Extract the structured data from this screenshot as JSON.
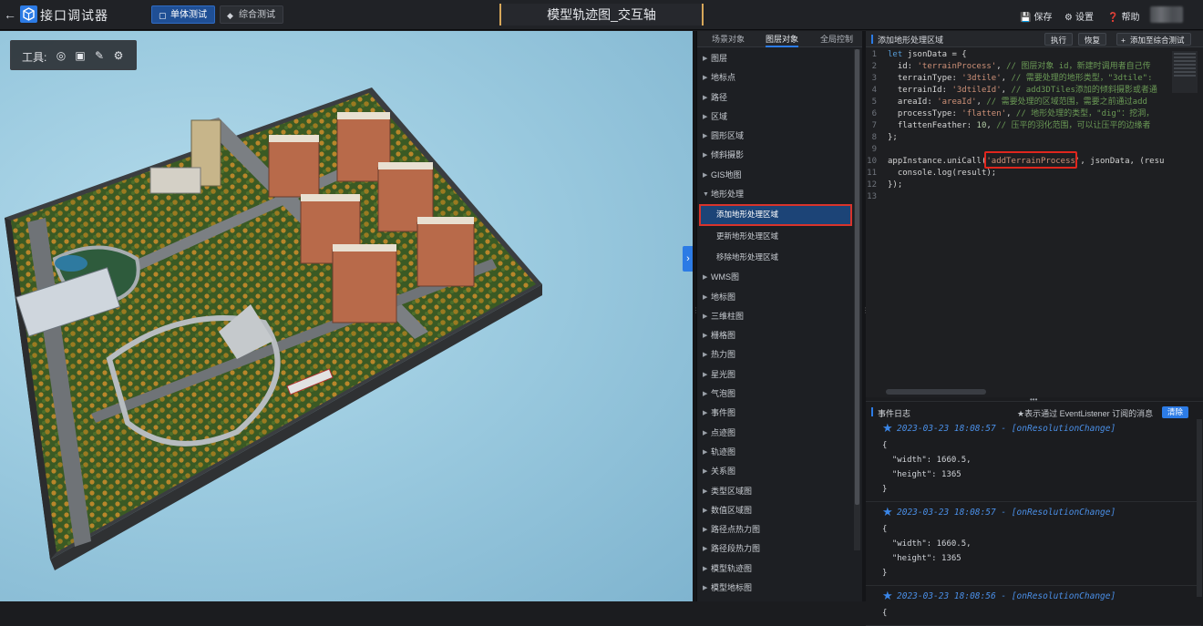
{
  "topbar": {
    "back_icon": "arrow-left-icon",
    "app_title": "接口调试器",
    "mode_single": "单体测试",
    "mode_combined": "综合测试",
    "page_title": "模型轨迹图_交互轴",
    "save": "保存",
    "settings": "设置",
    "help": "帮助"
  },
  "viewport": {
    "toolbar_label": "工具:",
    "tools": [
      "target-icon",
      "fullscreen-icon",
      "pen-icon",
      "gear-icon"
    ]
  },
  "tree": {
    "tabs": [
      "场景对象",
      "图层对象",
      "全局控制"
    ],
    "active_tab": "图层对象",
    "items": [
      {
        "label": "图层",
        "sub": false,
        "expanded": false
      },
      {
        "label": "地标点",
        "sub": false,
        "expanded": false
      },
      {
        "label": "路径",
        "sub": false,
        "expanded": false
      },
      {
        "label": "区域",
        "sub": false,
        "expanded": false
      },
      {
        "label": "圆形区域",
        "sub": false,
        "expanded": false
      },
      {
        "label": "倾斜摄影",
        "sub": false,
        "expanded": false
      },
      {
        "label": "GIS地图",
        "sub": false,
        "expanded": false
      },
      {
        "label": "地形处理",
        "sub": false,
        "expanded": true
      },
      {
        "label": "添加地形处理区域",
        "sub": true,
        "selected": true
      },
      {
        "label": "更新地形处理区域",
        "sub": true
      },
      {
        "label": "移除地形处理区域",
        "sub": true
      },
      {
        "label": "WMS图",
        "sub": false,
        "expanded": false
      },
      {
        "label": "地标图",
        "sub": false,
        "expanded": false
      },
      {
        "label": "三维柱图",
        "sub": false,
        "expanded": false
      },
      {
        "label": "栅格图",
        "sub": false,
        "expanded": false
      },
      {
        "label": "热力图",
        "sub": false,
        "expanded": false
      },
      {
        "label": "星光图",
        "sub": false,
        "expanded": false
      },
      {
        "label": "气泡图",
        "sub": false,
        "expanded": false
      },
      {
        "label": "事件图",
        "sub": false,
        "expanded": false
      },
      {
        "label": "点迹图",
        "sub": false,
        "expanded": false
      },
      {
        "label": "轨迹图",
        "sub": false,
        "expanded": false
      },
      {
        "label": "关系图",
        "sub": false,
        "expanded": false
      },
      {
        "label": "类型区域图",
        "sub": false,
        "expanded": false
      },
      {
        "label": "数值区域图",
        "sub": false,
        "expanded": false
      },
      {
        "label": "路径点热力图",
        "sub": false,
        "expanded": false
      },
      {
        "label": "路径段热力图",
        "sub": false,
        "expanded": false
      },
      {
        "label": "模型轨迹图",
        "sub": false,
        "expanded": false
      },
      {
        "label": "模型地标图",
        "sub": false,
        "expanded": false
      }
    ]
  },
  "code_panel": {
    "title": "添加地形处理区域",
    "btn_run": "执行",
    "btn_restore": "恢复",
    "btn_add": "添加至综合测试",
    "highlighted_call": "'addTerrainProcess'",
    "lines": [
      [
        {
          "t": "let ",
          "c": "kw"
        },
        {
          "t": "jsonData = {",
          "c": ""
        }
      ],
      [
        {
          "t": "  id: ",
          "c": ""
        },
        {
          "t": "'terrainProcess'",
          "c": "str"
        },
        {
          "t": ", ",
          "c": ""
        },
        {
          "t": "// 图层对象 id，新建时调用者自己传",
          "c": "cm"
        }
      ],
      [
        {
          "t": "  terrainType: ",
          "c": ""
        },
        {
          "t": "'3dtile'",
          "c": "str"
        },
        {
          "t": ", ",
          "c": ""
        },
        {
          "t": "// 需要处理的地形类型，\"3dtile\":",
          "c": "cm"
        }
      ],
      [
        {
          "t": "  terrainId: ",
          "c": ""
        },
        {
          "t": "'3dtileId'",
          "c": "str"
        },
        {
          "t": ", ",
          "c": ""
        },
        {
          "t": "// add3DTiles添加的倾斜摄影或者通",
          "c": "cm"
        }
      ],
      [
        {
          "t": "  areaId: ",
          "c": ""
        },
        {
          "t": "'areaId'",
          "c": "str"
        },
        {
          "t": ", ",
          "c": ""
        },
        {
          "t": "// 需要处理的区域范围，需要之前通过add",
          "c": "cm"
        }
      ],
      [
        {
          "t": "  processType: ",
          "c": ""
        },
        {
          "t": "'flatten'",
          "c": "str"
        },
        {
          "t": ", ",
          "c": ""
        },
        {
          "t": "// 地形处理的类型，\"dig\"：挖洞，",
          "c": "cm"
        }
      ],
      [
        {
          "t": "  flattenFeather: ",
          "c": ""
        },
        {
          "t": "10",
          "c": "num"
        },
        {
          "t": ", ",
          "c": ""
        },
        {
          "t": "// 压平的羽化范围，可以让压平的边缘者",
          "c": "cm"
        }
      ],
      [
        {
          "t": "};",
          "c": ""
        }
      ],
      [],
      [
        {
          "t": "appInstance.uniCall(",
          "c": ""
        },
        {
          "t": "'addTerrainProcess'",
          "c": "str"
        },
        {
          "t": ", jsonData, (resu",
          "c": ""
        }
      ],
      [
        {
          "t": "  console.log(result);",
          "c": ""
        }
      ],
      [
        {
          "t": "});",
          "c": ""
        }
      ],
      []
    ]
  },
  "event_log": {
    "title": "事件日志",
    "hint": "★表示通过 EventListener 订阅的消息",
    "clear": "清除",
    "entries": [
      {
        "time": "2023-03-23 18:08:57 - [onResolutionChange]",
        "body": [
          "{",
          "  \"width\": 1660.5,",
          "  \"height\": 1365",
          "}"
        ]
      },
      {
        "time": "2023-03-23 18:08:57 - [onResolutionChange]",
        "body": [
          "{",
          "  \"width\": 1660.5,",
          "  \"height\": 1365",
          "}"
        ]
      },
      {
        "time": "2023-03-23 18:08:56 - [onResolutionChange]",
        "body": [
          "{"
        ]
      }
    ]
  },
  "colors": {
    "accent": "#2c7be5",
    "highlight_border": "#e0261d",
    "title_bracket": "#d7a75a"
  }
}
